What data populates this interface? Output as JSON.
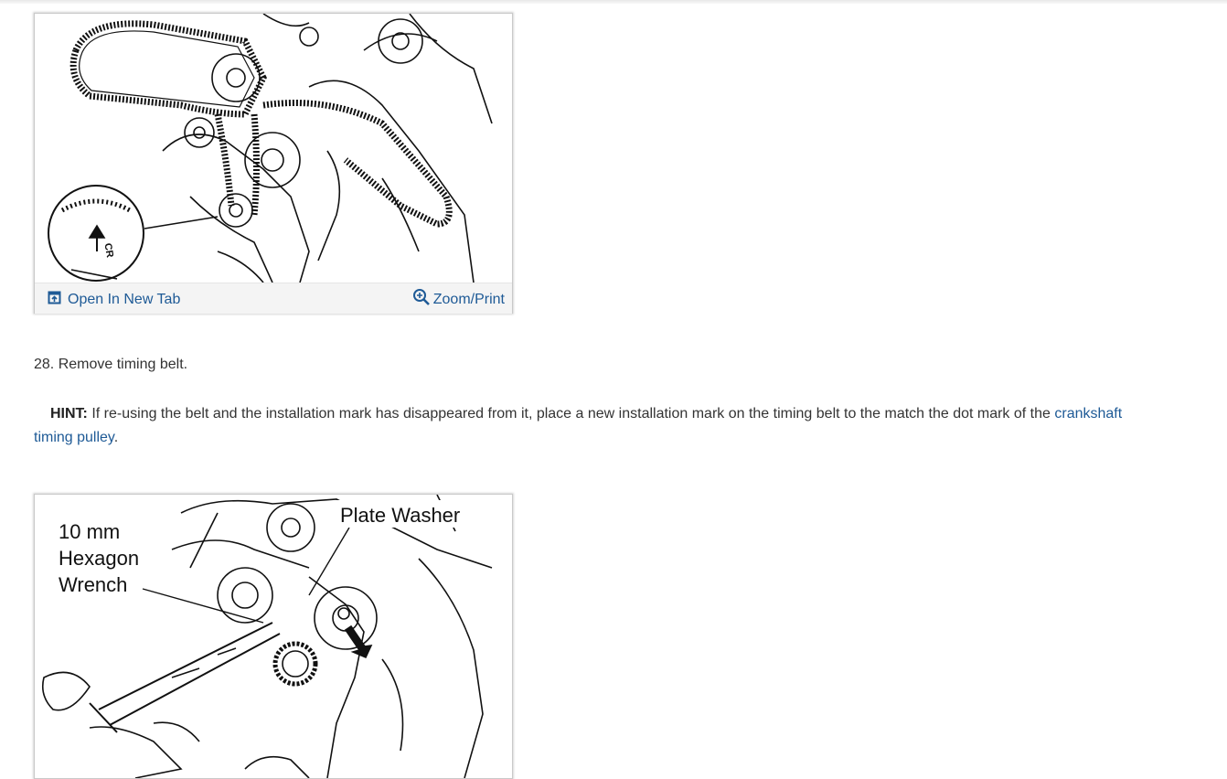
{
  "figure1": {
    "open_label": "Open In New Tab",
    "zoom_label": "Zoom/Print",
    "callout_text": "CR"
  },
  "step": {
    "number": "28.",
    "text": "Remove timing belt."
  },
  "hint": {
    "label": "HINT:",
    "text_before": "If re-using the belt and the installation mark has disappeared from it, place a new installation mark on the timing belt to the match the dot mark of the",
    "link_text": "crankshaft timing pulley",
    "text_after": "."
  },
  "figure2": {
    "label_wrench_line1": "10 mm",
    "label_wrench_line2": "Hexagon",
    "label_wrench_line3": "Wrench",
    "label_washer": "Plate Washer"
  },
  "colors": {
    "link": "#1e5a96",
    "text": "#333333",
    "footer_bg": "#f4f4f4"
  },
  "icons": {
    "open": "open-in-new-tab-icon",
    "zoom": "zoom-in-icon"
  }
}
